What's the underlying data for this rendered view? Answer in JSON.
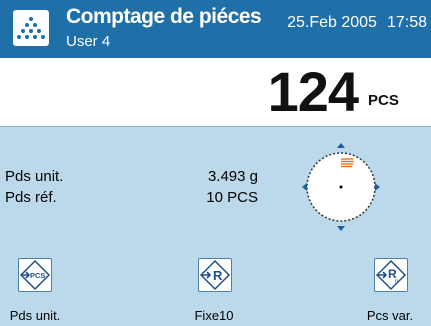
{
  "header": {
    "title": "Comptage de piéces",
    "user": "User 4",
    "date": "25.Feb 2005",
    "time": "17:58",
    "icon": "dots-triangle-icon"
  },
  "result": {
    "value": "124",
    "unit": "PCS"
  },
  "info": [
    {
      "label": "Pds unit.",
      "value": "3.493 g"
    },
    {
      "label": "Pds réf.",
      "value": "10 PCS"
    }
  ],
  "gauge": {
    "icon": "dynamic-graphic-icon",
    "level_fraction": 0.08
  },
  "softkeys": [
    {
      "label": "Pds unit.",
      "icon": "set-pcs-weight-icon",
      "glyph": "PCS"
    },
    {
      "label": "Fixe10",
      "icon": "fixed-reference-icon",
      "glyph": "R"
    },
    {
      "label": "Pcs var.",
      "icon": "variable-reference-icon",
      "glyph": "R"
    }
  ],
  "colors": {
    "header": "#1f6fa8",
    "info_background": "#bcd9ec",
    "gauge_fill": "#e8731e"
  }
}
